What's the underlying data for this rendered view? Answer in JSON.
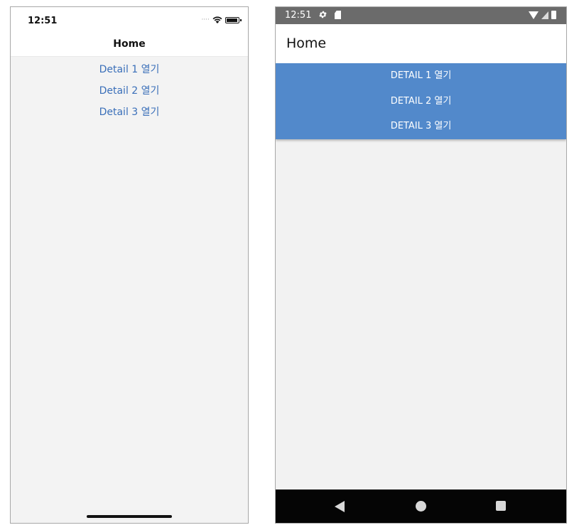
{
  "ios": {
    "status_time": "12:51",
    "signal_dots": "····",
    "title": "Home",
    "links": [
      {
        "label": "Detail 1 열기"
      },
      {
        "label": "Detail 2 열기"
      },
      {
        "label": "Detail 3 열기"
      }
    ],
    "link_color": "#3a6fb9"
  },
  "android": {
    "status_time": "12:51",
    "title": "Home",
    "buttons": [
      {
        "label": "DETAIL 1 열기"
      },
      {
        "label": "DETAIL 2 열기"
      },
      {
        "label": "DETAIL 3 열기"
      }
    ],
    "button_color": "#5289cb",
    "status_icons_left": [
      "gear-icon",
      "sd-card-icon"
    ],
    "status_icons_right": [
      "wifi-icon",
      "cell-signal-icon",
      "battery-icon"
    ],
    "nav_icons": [
      "back-icon",
      "home-icon",
      "recents-icon"
    ]
  }
}
